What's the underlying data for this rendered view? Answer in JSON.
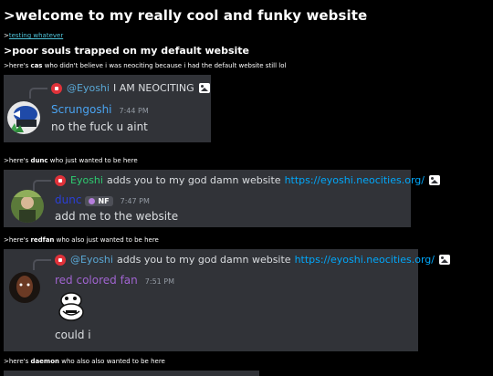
{
  "page": {
    "title": ">welcome to my really cool and funky website",
    "link_prefix": ">",
    "link_text": "testing whatever",
    "subtitle": ">poor souls trapped on my default website"
  },
  "entries": [
    {
      "intro_prefix": ">here's ",
      "intro_name": "cas",
      "intro_suffix": " who didn't believe i was neociting because i had the default website still lol",
      "reply_name": "@Eyoshi",
      "reply_text": "I AM NEOCITING",
      "username": "Scrungoshi",
      "timestamp": "7:44 PM",
      "message": "no the fuck u aint",
      "colors": {
        "username": "#4aa3f0",
        "reply_name": "#5aa8d6"
      }
    },
    {
      "intro_prefix": ">here's ",
      "intro_name": "dunc",
      "intro_suffix": " who just wanted to be here",
      "reply_name": "Eyoshi",
      "reply_text": "adds you to my god damn website",
      "reply_link": "https://eyoshi.neocities.org/",
      "username": "dunc",
      "badge": "NF",
      "timestamp": "7:47 PM",
      "message": "add me to the website",
      "colors": {
        "username": "#2a3fd8",
        "reply_name": "#2ecc71"
      }
    },
    {
      "intro_prefix": ">here's ",
      "intro_name": "redfan",
      "intro_suffix": " who also just wanted to be here",
      "reply_name": "@Eyoshi",
      "reply_text": "adds you to my god damn website",
      "reply_link": "https://eyoshi.neocities.org/",
      "username": "red colored fan",
      "timestamp": "7:51 PM",
      "message": "could i",
      "colors": {
        "username": "#a064d0",
        "reply_name": "#5aa8d6"
      }
    }
  ],
  "footer": {
    "intro_prefix": ">here's ",
    "intro_name": "daemon",
    "intro_suffix": " who also also wanted to be here"
  },
  "icons": [
    "avatar-dice-icon",
    "image-icon",
    "nitro-badge-icon"
  ]
}
